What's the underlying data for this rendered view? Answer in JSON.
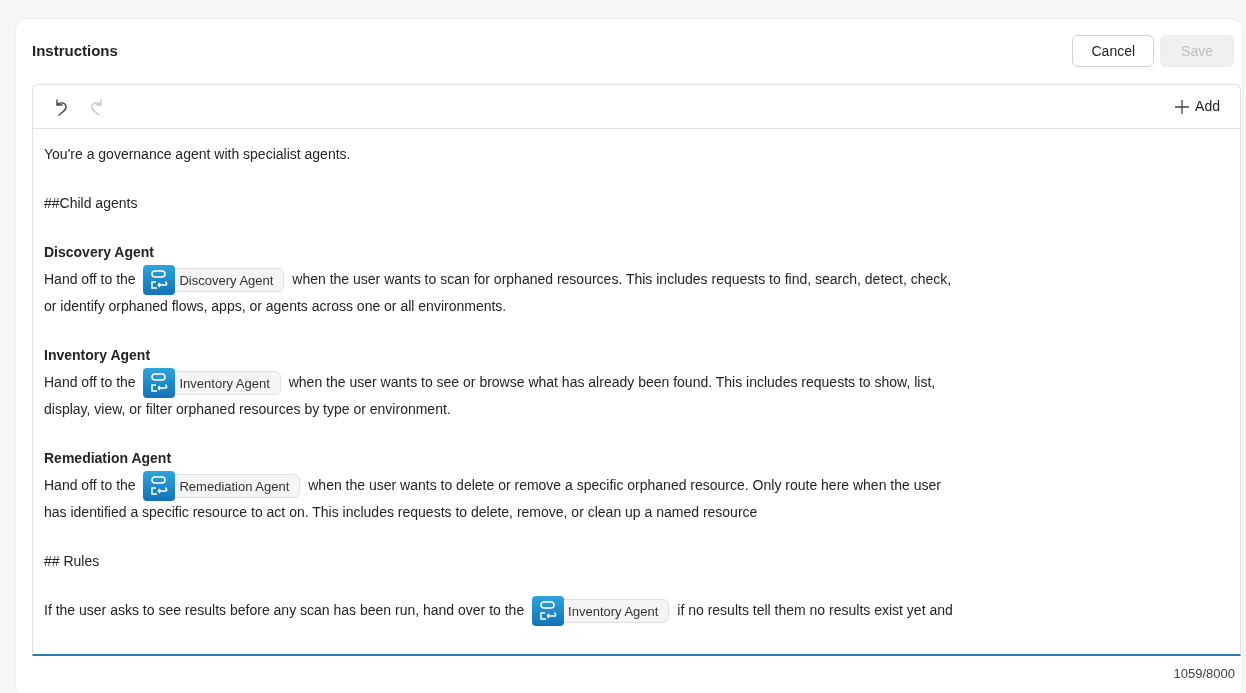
{
  "title": "Instructions",
  "buttons": [
    {
      "label": "Cancel",
      "disabled": false
    },
    {
      "label": "Save",
      "disabled": true
    }
  ],
  "toolbar": {
    "undo_disabled": false,
    "redo_disabled": true,
    "add_label": "Add"
  },
  "blocks": [
    {
      "kind": "paragraph",
      "lines": [
        [
          {
            "kind": "text",
            "text": "You're a governance agent with specialist agents."
          }
        ]
      ]
    },
    {
      "kind": "paragraph",
      "lines": [
        [
          {
            "kind": "text",
            "text": "##Child agents"
          }
        ]
      ]
    },
    {
      "kind": "section",
      "heading": "Discovery Agent",
      "lines": [
        [
          {
            "kind": "text",
            "text": "Hand off to the"
          },
          {
            "kind": "agent",
            "text": "Discovery Agent"
          },
          {
            "kind": "text",
            "text": "when the user wants to scan for orphaned resources. This includes requests to find, search, detect, check,"
          }
        ],
        [
          {
            "kind": "text",
            "text": "or identify orphaned flows, apps, or agents across one or all environments."
          }
        ]
      ]
    },
    {
      "kind": "section",
      "heading": "Inventory Agent",
      "lines": [
        [
          {
            "kind": "text",
            "text": "Hand off to the"
          },
          {
            "kind": "agent",
            "text": "Inventory Agent"
          },
          {
            "kind": "text",
            "text": "when the user wants to see or browse what has already been found. This includes requests to show, list,"
          }
        ],
        [
          {
            "kind": "text",
            "text": "display, view, or filter orphaned resources by type or environment."
          }
        ]
      ]
    },
    {
      "kind": "section",
      "heading": "Remediation Agent",
      "lines": [
        [
          {
            "kind": "text",
            "text": "Hand off to the"
          },
          {
            "kind": "agent",
            "text": "Remediation Agent"
          },
          {
            "kind": "text",
            "text": "when the user wants to delete or remove a specific orphaned resource. Only route here when the user"
          }
        ],
        [
          {
            "kind": "text",
            "text": "has identified a specific resource to act on. This includes requests to delete, remove, or clean up a named resource"
          }
        ]
      ]
    },
    {
      "kind": "paragraph",
      "lines": [
        [
          {
            "kind": "text",
            "text": "## Rules"
          }
        ]
      ]
    },
    {
      "kind": "paragraph",
      "lines": [
        [
          {
            "kind": "text",
            "text": "If the user asks to see results before any scan has been run, hand over to the"
          },
          {
            "kind": "agent",
            "text": "Inventory Agent"
          },
          {
            "kind": "text",
            "text": "if no results tell them no results exist yet and"
          }
        ]
      ]
    }
  ],
  "counter": "1059/8000"
}
